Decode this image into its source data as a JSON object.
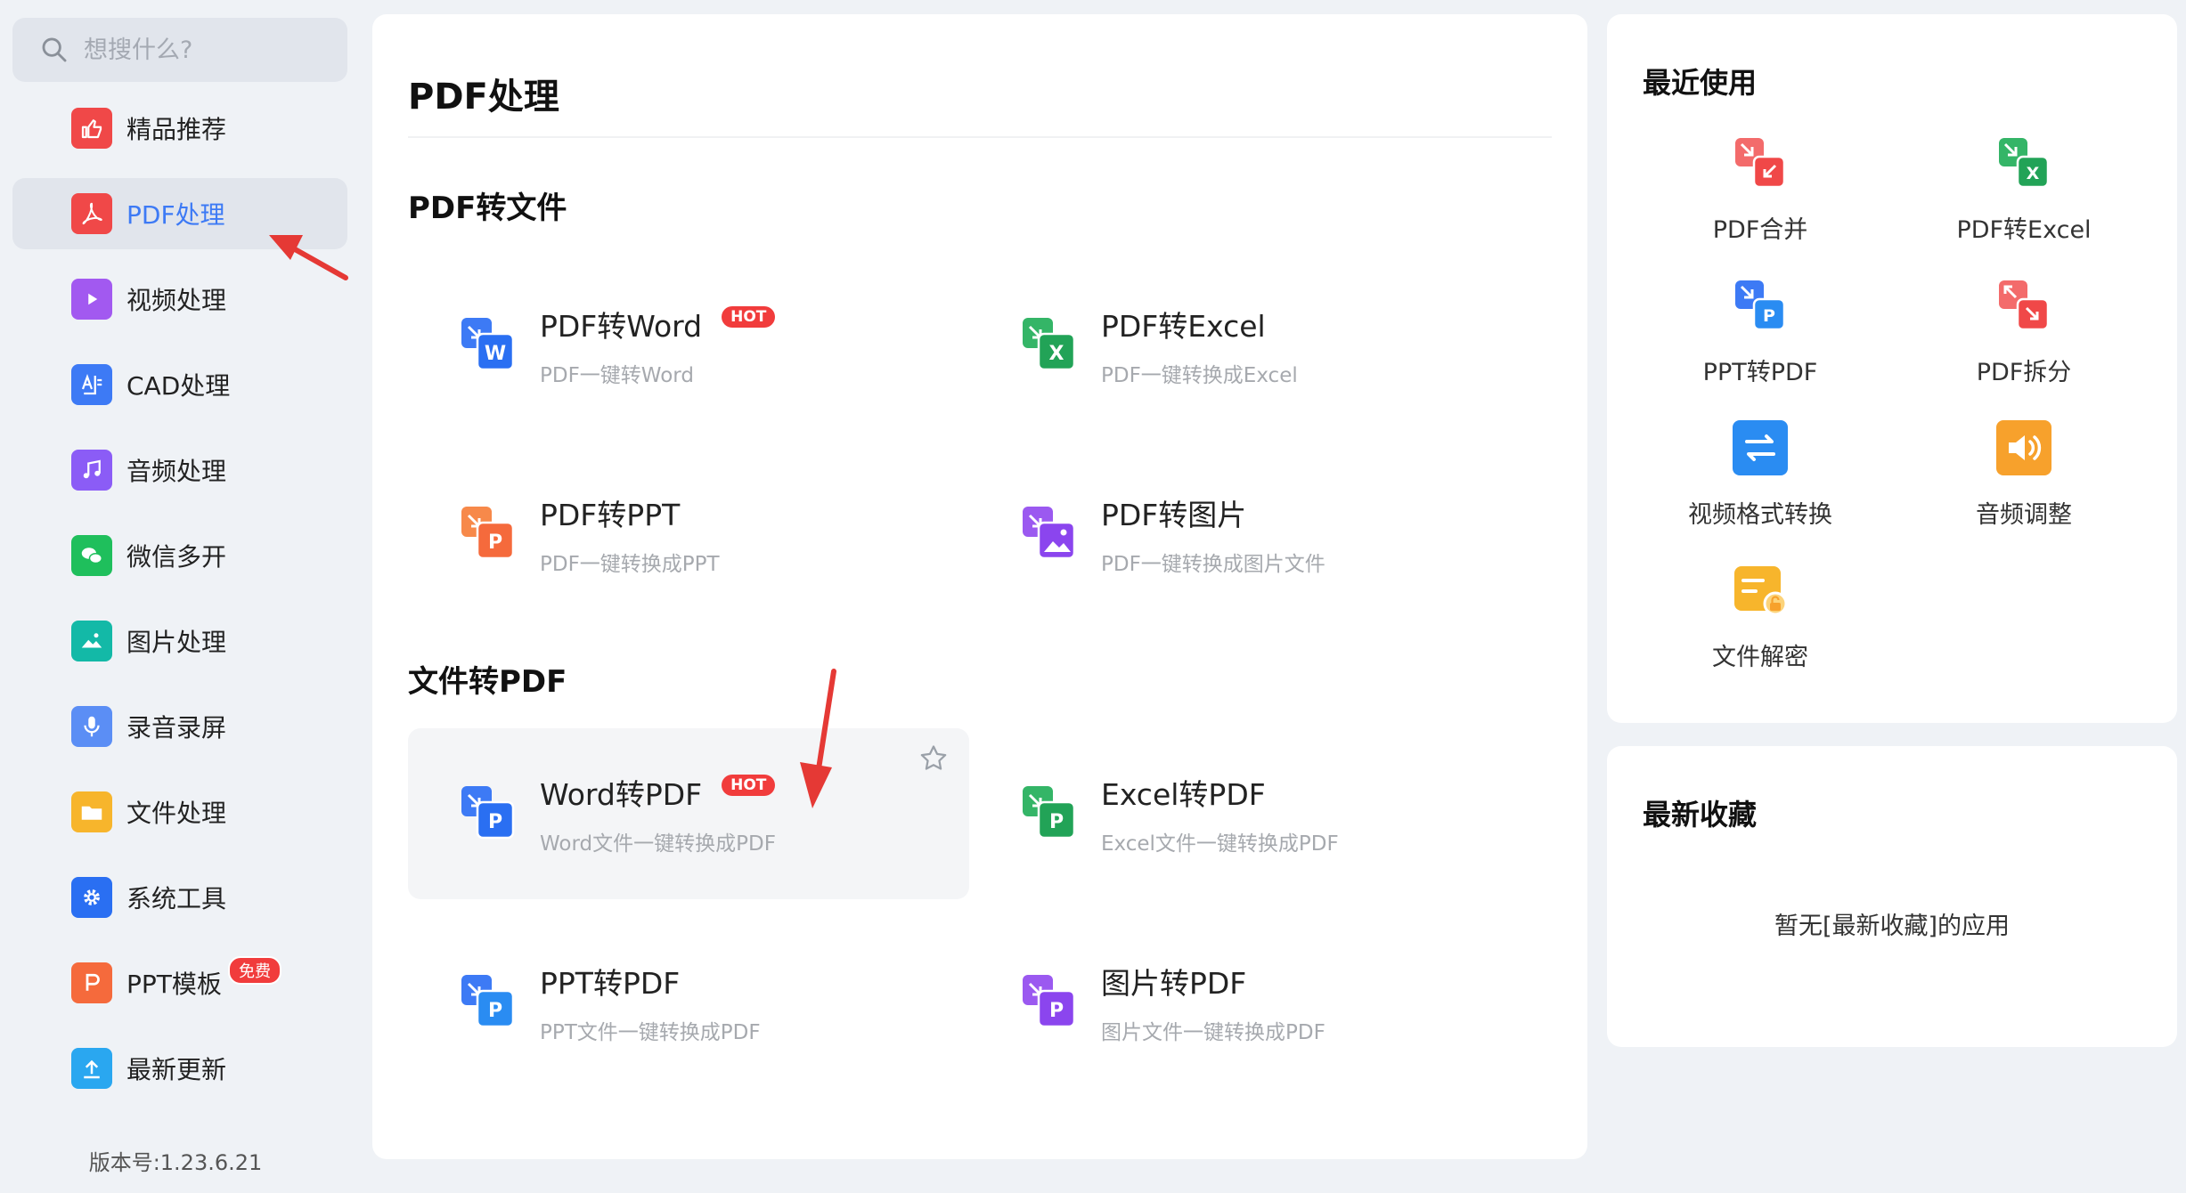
{
  "search": {
    "placeholder": "想搜什么?"
  },
  "sidebar": {
    "items": [
      {
        "label": "精品推荐",
        "icon": "thumbs-up-icon",
        "color": "#f04848"
      },
      {
        "label": "PDF处理",
        "icon": "pdf-icon",
        "color": "#f04848",
        "active": true
      },
      {
        "label": "视频处理",
        "icon": "play-icon",
        "color": "#a259f0"
      },
      {
        "label": "CAD处理",
        "icon": "cad-icon",
        "color": "#3d7af5"
      },
      {
        "label": "音频处理",
        "icon": "music-icon",
        "color": "#8b5cf6"
      },
      {
        "label": "微信多开",
        "icon": "wechat-icon",
        "color": "#1fbf5c"
      },
      {
        "label": "图片处理",
        "icon": "image-icon",
        "color": "#13b9a7"
      },
      {
        "label": "录音录屏",
        "icon": "microphone-icon",
        "color": "#5b8ef5"
      },
      {
        "label": "文件处理",
        "icon": "folder-icon",
        "color": "#f7b52c"
      },
      {
        "label": "系统工具",
        "icon": "gear-icon",
        "color": "#2a6ff2"
      },
      {
        "label": "PPT模板",
        "icon": "ppt-icon",
        "color": "#f56a3c",
        "badge": "免费"
      },
      {
        "label": "最新更新",
        "icon": "upload-icon",
        "color": "#2aa7f0"
      }
    ],
    "version": "版本号:1.23.6.21"
  },
  "main": {
    "title": "PDF处理",
    "sections": [
      {
        "title": "PDF转文件"
      },
      {
        "title": "文件转PDF"
      }
    ],
    "tools": [
      {
        "name": "PDF转Word",
        "desc": "PDF一键转Word",
        "hot": "HOT",
        "icon": "pdf-to-word-icon"
      },
      {
        "name": "PDF转Excel",
        "desc": "PDF一键转换成Excel",
        "icon": "pdf-to-excel-icon"
      },
      {
        "name": "PDF转PPT",
        "desc": "PDF一键转换成PPT",
        "icon": "pdf-to-ppt-icon"
      },
      {
        "name": "PDF转图片",
        "desc": "PDF一键转换成图片文件",
        "icon": "pdf-to-image-icon"
      },
      {
        "name": "Word转PDF",
        "desc": "Word文件一键转换成PDF",
        "hot": "HOT",
        "icon": "word-to-pdf-icon"
      },
      {
        "name": "Excel转PDF",
        "desc": "Excel文件一键转换成PDF",
        "icon": "excel-to-pdf-icon"
      },
      {
        "name": "PPT转PDF",
        "desc": "PPT文件一键转换成PDF",
        "icon": "ppt-to-pdf-icon"
      },
      {
        "name": "图片转PDF",
        "desc": "图片文件一键转换成PDF",
        "icon": "image-to-pdf-icon"
      }
    ]
  },
  "recent": {
    "title": "最近使用",
    "items": [
      {
        "label": "PDF合并",
        "icon": "pdf-merge-icon"
      },
      {
        "label": "PDF转Excel",
        "icon": "pdf-to-excel-icon"
      },
      {
        "label": "PPT转PDF",
        "icon": "ppt-to-pdf-icon"
      },
      {
        "label": "PDF拆分",
        "icon": "pdf-split-icon"
      },
      {
        "label": "视频格式转换",
        "icon": "video-convert-icon"
      },
      {
        "label": "音频调整",
        "icon": "audio-adjust-icon"
      },
      {
        "label": "文件解密",
        "icon": "file-decrypt-icon"
      }
    ]
  },
  "favorites": {
    "title": "最新收藏",
    "empty_text": "暂无[最新收藏]的应用"
  },
  "colors": {
    "accent": "#3d7af5",
    "hot": "#f13c3c",
    "annotation_arrow": "#e53935"
  }
}
